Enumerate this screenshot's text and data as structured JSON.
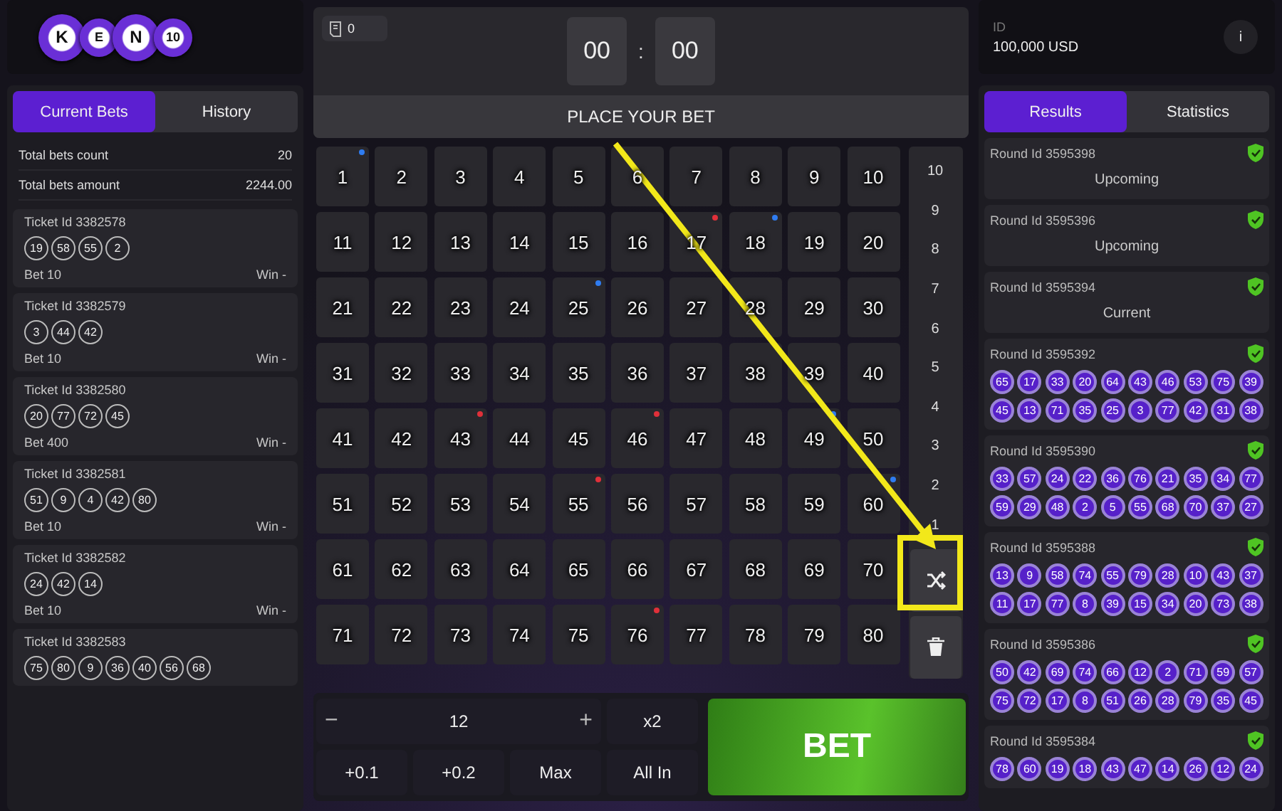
{
  "logo": {
    "letters": [
      "K",
      "E",
      "N",
      "10"
    ]
  },
  "bets_panel": {
    "tabs": [
      {
        "label": "Current Bets",
        "selected": true
      },
      {
        "label": "History",
        "selected": false
      }
    ],
    "summary": [
      {
        "label": "Total bets count",
        "value": "20"
      },
      {
        "label": "Total bets amount",
        "value": "2244.00"
      }
    ],
    "tickets": [
      {
        "title": "Ticket Id 3382578",
        "numbers": [
          "19",
          "58",
          "55",
          "2"
        ],
        "bet": "Bet 10",
        "win": "Win -"
      },
      {
        "title": "Ticket Id 3382579",
        "numbers": [
          "3",
          "44",
          "42"
        ],
        "bet": "Bet 10",
        "win": "Win -"
      },
      {
        "title": "Ticket Id 3382580",
        "numbers": [
          "20",
          "77",
          "72",
          "45"
        ],
        "bet": "Bet 400",
        "win": "Win -"
      },
      {
        "title": "Ticket Id 3382581",
        "numbers": [
          "51",
          "9",
          "4",
          "42",
          "80"
        ],
        "bet": "Bet 10",
        "win": "Win -"
      },
      {
        "title": "Ticket Id 3382582",
        "numbers": [
          "24",
          "42",
          "14"
        ],
        "bet": "Bet 10",
        "win": "Win -"
      },
      {
        "title": "Ticket Id 3382583",
        "numbers": [
          "75",
          "80",
          "9",
          "36",
          "40",
          "56",
          "68"
        ]
      }
    ]
  },
  "game": {
    "ticket_count": "0",
    "timer": {
      "minutes": "00",
      "separator": ":",
      "seconds": "00"
    },
    "banner": "PLACE YOUR BET",
    "cells": [
      {
        "n": "1",
        "color": "#2f7cf0"
      },
      {
        "n": "2"
      },
      {
        "n": "3"
      },
      {
        "n": "4"
      },
      {
        "n": "5"
      },
      {
        "n": "6"
      },
      {
        "n": "7"
      },
      {
        "n": "8"
      },
      {
        "n": "9"
      },
      {
        "n": "10"
      },
      {
        "n": "11"
      },
      {
        "n": "12"
      },
      {
        "n": "13"
      },
      {
        "n": "14"
      },
      {
        "n": "15"
      },
      {
        "n": "16"
      },
      {
        "n": "17",
        "color": "#e0303a"
      },
      {
        "n": "18",
        "color": "#2f7cf0"
      },
      {
        "n": "19"
      },
      {
        "n": "20"
      },
      {
        "n": "21"
      },
      {
        "n": "22"
      },
      {
        "n": "23"
      },
      {
        "n": "24"
      },
      {
        "n": "25",
        "color": "#2f7cf0"
      },
      {
        "n": "26"
      },
      {
        "n": "27"
      },
      {
        "n": "28"
      },
      {
        "n": "29"
      },
      {
        "n": "30"
      },
      {
        "n": "31"
      },
      {
        "n": "32"
      },
      {
        "n": "33"
      },
      {
        "n": "34"
      },
      {
        "n": "35"
      },
      {
        "n": "36"
      },
      {
        "n": "37"
      },
      {
        "n": "38"
      },
      {
        "n": "39"
      },
      {
        "n": "40"
      },
      {
        "n": "41"
      },
      {
        "n": "42"
      },
      {
        "n": "43",
        "color": "#e0303a"
      },
      {
        "n": "44"
      },
      {
        "n": "45"
      },
      {
        "n": "46",
        "color": "#e0303a"
      },
      {
        "n": "47"
      },
      {
        "n": "48"
      },
      {
        "n": "49",
        "color": "#2f7cf0"
      },
      {
        "n": "50"
      },
      {
        "n": "51"
      },
      {
        "n": "52"
      },
      {
        "n": "53"
      },
      {
        "n": "54"
      },
      {
        "n": "55",
        "color": "#e0303a"
      },
      {
        "n": "56"
      },
      {
        "n": "57"
      },
      {
        "n": "58"
      },
      {
        "n": "59"
      },
      {
        "n": "60",
        "color": "#2f7cf0"
      },
      {
        "n": "61"
      },
      {
        "n": "62"
      },
      {
        "n": "63"
      },
      {
        "n": "64"
      },
      {
        "n": "65"
      },
      {
        "n": "66"
      },
      {
        "n": "67"
      },
      {
        "n": "68"
      },
      {
        "n": "69"
      },
      {
        "n": "70"
      },
      {
        "n": "71"
      },
      {
        "n": "72"
      },
      {
        "n": "73"
      },
      {
        "n": "74"
      },
      {
        "n": "75"
      },
      {
        "n": "76",
        "color": "#e0303a"
      },
      {
        "n": "77"
      },
      {
        "n": "78"
      },
      {
        "n": "79"
      },
      {
        "n": "80"
      }
    ],
    "pick_counts": [
      "10",
      "9",
      "8",
      "7",
      "6",
      "5",
      "4",
      "3",
      "2",
      "1"
    ],
    "stake": {
      "minus": "−",
      "value": "12",
      "plus": "+"
    },
    "buttons": [
      "x2",
      "+0.1",
      "+0.2",
      "Max",
      "All In"
    ],
    "bet": "BET"
  },
  "account": {
    "label": "ID",
    "balance": "100,000 USD",
    "info": "i"
  },
  "results_panel": {
    "tabs": [
      {
        "label": "Results",
        "selected": true
      },
      {
        "label": "Statistics",
        "selected": false
      }
    ],
    "rounds": [
      {
        "title": "Round Id 3595398",
        "status": "Upcoming"
      },
      {
        "title": "Round Id 3595396",
        "status": "Upcoming"
      },
      {
        "title": "Round Id 3595394",
        "status": "Current"
      },
      {
        "title": "Round Id 3595392",
        "numbers": [
          "65",
          "17",
          "33",
          "20",
          "64",
          "43",
          "46",
          "53",
          "75",
          "39",
          "45",
          "13",
          "71",
          "35",
          "25",
          "3",
          "77",
          "42",
          "31",
          "38"
        ]
      },
      {
        "title": "Round Id 3595390",
        "numbers": [
          "33",
          "57",
          "24",
          "22",
          "36",
          "76",
          "21",
          "35",
          "34",
          "77",
          "59",
          "29",
          "48",
          "2",
          "5",
          "55",
          "68",
          "70",
          "37",
          "27"
        ]
      },
      {
        "title": "Round Id 3595388",
        "numbers": [
          "13",
          "9",
          "58",
          "74",
          "55",
          "79",
          "28",
          "10",
          "43",
          "37",
          "11",
          "17",
          "77",
          "8",
          "39",
          "15",
          "34",
          "20",
          "73",
          "38"
        ]
      },
      {
        "title": "Round Id 3595386",
        "numbers": [
          "50",
          "42",
          "69",
          "74",
          "66",
          "12",
          "2",
          "71",
          "59",
          "57",
          "75",
          "72",
          "17",
          "8",
          "51",
          "26",
          "28",
          "79",
          "35",
          "45"
        ]
      },
      {
        "title": "Round Id 3595384",
        "numbers": [
          "78",
          "60",
          "19",
          "18",
          "43",
          "47",
          "14",
          "26",
          "12",
          "24"
        ]
      }
    ]
  }
}
